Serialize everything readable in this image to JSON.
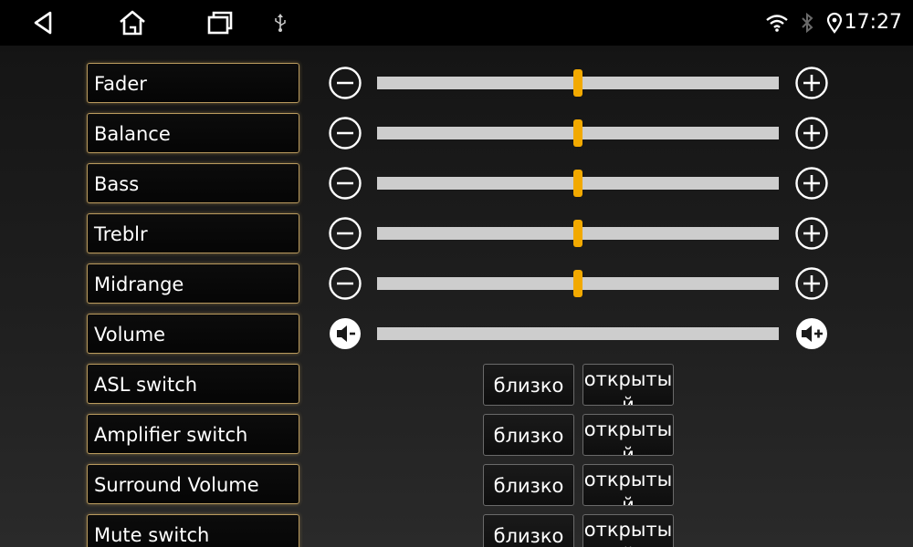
{
  "status_bar": {
    "time": "17:27",
    "icons": [
      "wifi-icon",
      "bluetooth-icon",
      "location-pin-icon",
      "usb-icon"
    ]
  },
  "nav_bar": {
    "buttons": [
      "back-icon",
      "home-icon",
      "recent-apps-icon"
    ]
  },
  "colors": {
    "thumb": "#f2a900",
    "track": "#cdcdcd",
    "label_border": "#b99a5e"
  },
  "sliders": [
    {
      "label": "Fader",
      "level": 0.5,
      "minus_icon": "minus-icon",
      "plus_icon": "plus-icon"
    },
    {
      "label": "Balance",
      "level": 0.5,
      "minus_icon": "minus-icon",
      "plus_icon": "plus-icon"
    },
    {
      "label": "Bass",
      "level": 0.5,
      "minus_icon": "minus-icon",
      "plus_icon": "plus-icon"
    },
    {
      "label": "Treblr",
      "level": 0.5,
      "minus_icon": "minus-icon",
      "plus_icon": "plus-icon"
    },
    {
      "label": "Midrange",
      "level": 0.5,
      "minus_icon": "minus-icon",
      "plus_icon": "plus-icon"
    },
    {
      "label": "Volume",
      "level": 0,
      "minus_icon": "volume-down-icon",
      "plus_icon": "volume-up-icon"
    }
  ],
  "switches": [
    {
      "label": "ASL switch",
      "close_label": "близко",
      "open_label": "открытый"
    },
    {
      "label": "Amplifier switch",
      "close_label": "близко",
      "open_label": "открытый"
    },
    {
      "label": "Surround Volume",
      "close_label": "близко",
      "open_label": "открытый"
    },
    {
      "label": "Mute switch",
      "close_label": "близко",
      "open_label": "открытый"
    }
  ]
}
